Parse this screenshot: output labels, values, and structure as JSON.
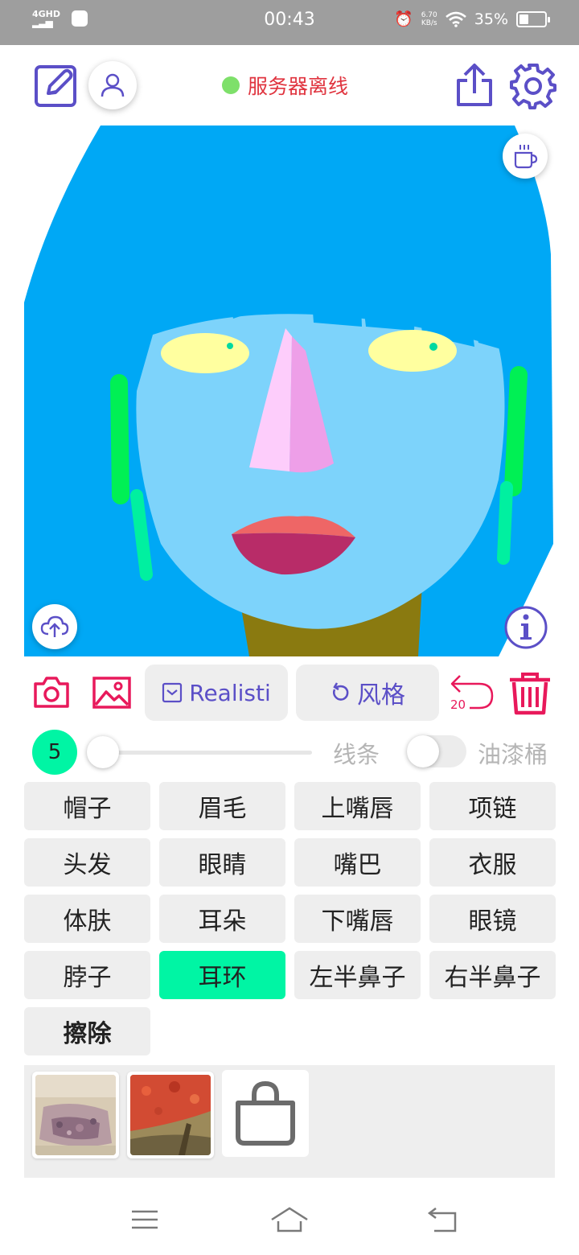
{
  "status_bar": {
    "network": "4GHD",
    "time": "00:43",
    "speed_value": "6.70",
    "speed_unit": "KB/s",
    "battery": "35%",
    "battery_level": 0.35
  },
  "header": {
    "server_status": "服务器离线",
    "server_status_color": "#e0343f",
    "status_dot_color": "#7ee06a"
  },
  "toolbar": {
    "realistic_label": "Realisti",
    "style_label": "风格",
    "undo_count": "20",
    "accent_color": "#5b4fc7",
    "danger_color": "#e8195b"
  },
  "brush": {
    "size": "5",
    "slider_level": 0.0,
    "line_label": "线条",
    "bucket_label": "油漆桶",
    "bucket_enabled": false
  },
  "parts": [
    {
      "label": "帽子",
      "active": false
    },
    {
      "label": "眉毛",
      "active": false
    },
    {
      "label": "上嘴唇",
      "active": false
    },
    {
      "label": "项链",
      "active": false
    },
    {
      "label": "头发",
      "active": false
    },
    {
      "label": "眼睛",
      "active": false
    },
    {
      "label": "嘴巴",
      "active": false
    },
    {
      "label": "衣服",
      "active": false
    },
    {
      "label": "体肤",
      "active": false
    },
    {
      "label": "耳朵",
      "active": false
    },
    {
      "label": "下嘴唇",
      "active": false
    },
    {
      "label": "眼镜",
      "active": false
    },
    {
      "label": "脖子",
      "active": false
    },
    {
      "label": "耳环",
      "active": true
    },
    {
      "label": "左半鼻子",
      "active": false
    },
    {
      "label": "右半鼻子",
      "active": false
    },
    {
      "label": "擦除",
      "active": false,
      "bold": true
    }
  ],
  "colors": {
    "hair": "#00a8f5",
    "skin": "#7dd3fb",
    "eyes": "#ffff9f",
    "pupil": "#00d9a0",
    "nose_left": "#fdcdfb",
    "nose_right": "#ee9fe8",
    "upper_lip": "#ee6666",
    "lower_lip": "#b82c68",
    "neck": "#8a7a10",
    "ear": "#00f054",
    "earring": "#00f0a0",
    "active_part": "#00f5a4"
  },
  "textures": [
    {
      "name": "texture-1"
    },
    {
      "name": "texture-2"
    }
  ]
}
